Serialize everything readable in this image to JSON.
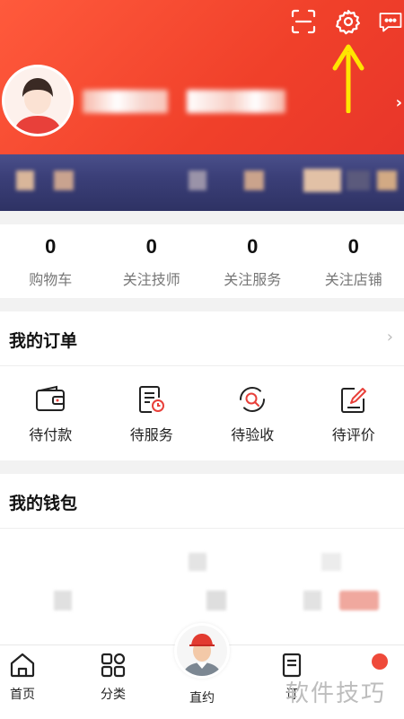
{
  "colors": {
    "header_red": "#f0402a",
    "band_navy": "#3b3f78",
    "accent_yellow": "#ffe600",
    "page_bg": "#f2f2f2"
  },
  "header": {
    "icons": [
      "scan-icon",
      "settings-icon",
      "message-icon"
    ]
  },
  "counts": [
    {
      "value": "0",
      "label": "购物车"
    },
    {
      "value": "0",
      "label": "关注技师"
    },
    {
      "value": "0",
      "label": "关注服务"
    },
    {
      "value": "0",
      "label": "关注店铺"
    }
  ],
  "orders": {
    "title": "我的订单",
    "items": [
      {
        "label": "待付款",
        "icon": "wallet-icon"
      },
      {
        "label": "待服务",
        "icon": "service-doc-icon"
      },
      {
        "label": "待验收",
        "icon": "inspect-icon"
      },
      {
        "label": "待评价",
        "icon": "review-edit-icon"
      }
    ]
  },
  "wallet": {
    "title": "我的钱包"
  },
  "nav": {
    "items": [
      {
        "label": "首页",
        "icon": "home-icon"
      },
      {
        "label": "分类",
        "icon": "category-icon"
      },
      {
        "label": "直约",
        "icon": "technician-avatar-icon"
      },
      {
        "label": "订",
        "icon": "order-icon"
      }
    ]
  },
  "watermark": "软件技巧"
}
